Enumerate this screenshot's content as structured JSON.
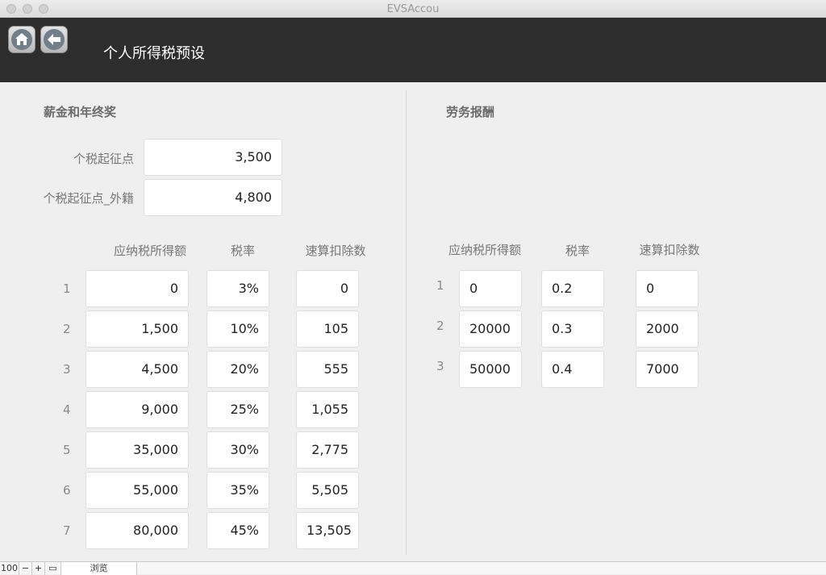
{
  "window": {
    "title": "EVSAccou"
  },
  "header": {
    "title": "个人所得税预设",
    "home_icon": "home-icon",
    "back_icon": "back-arrow-icon"
  },
  "salary": {
    "title": "薪金和年终奖",
    "threshold_label": "个税起征点",
    "threshold_value": "3,500",
    "foreign_threshold_label": "个税起征点_外籍",
    "foreign_threshold_value": "4,800",
    "headers": [
      "应纳税所得额",
      "税率",
      "速算扣除数"
    ],
    "rows": [
      {
        "no": "1",
        "income": "0",
        "rate": "3%",
        "deduction": "0"
      },
      {
        "no": "2",
        "income": "1,500",
        "rate": "10%",
        "deduction": "105"
      },
      {
        "no": "3",
        "income": "4,500",
        "rate": "20%",
        "deduction": "555"
      },
      {
        "no": "4",
        "income": "9,000",
        "rate": "25%",
        "deduction": "1,055"
      },
      {
        "no": "5",
        "income": "35,000",
        "rate": "30%",
        "deduction": "2,775"
      },
      {
        "no": "6",
        "income": "55,000",
        "rate": "35%",
        "deduction": "5,505"
      },
      {
        "no": "7",
        "income": "80,000",
        "rate": "45%",
        "deduction": "13,505"
      }
    ]
  },
  "service": {
    "title": "劳务报酬",
    "headers": [
      "应纳税所得额",
      "税率",
      "速算扣除数"
    ],
    "rows": [
      {
        "no": "1",
        "income": "0",
        "rate": "0.2",
        "deduction": "0"
      },
      {
        "no": "2",
        "income": "20000",
        "rate": "0.3",
        "deduction": "2000"
      },
      {
        "no": "3",
        "income": "50000",
        "rate": "0.4",
        "deduction": "7000"
      }
    ]
  },
  "statusbar": {
    "zoom": "100",
    "mode": "浏览"
  }
}
